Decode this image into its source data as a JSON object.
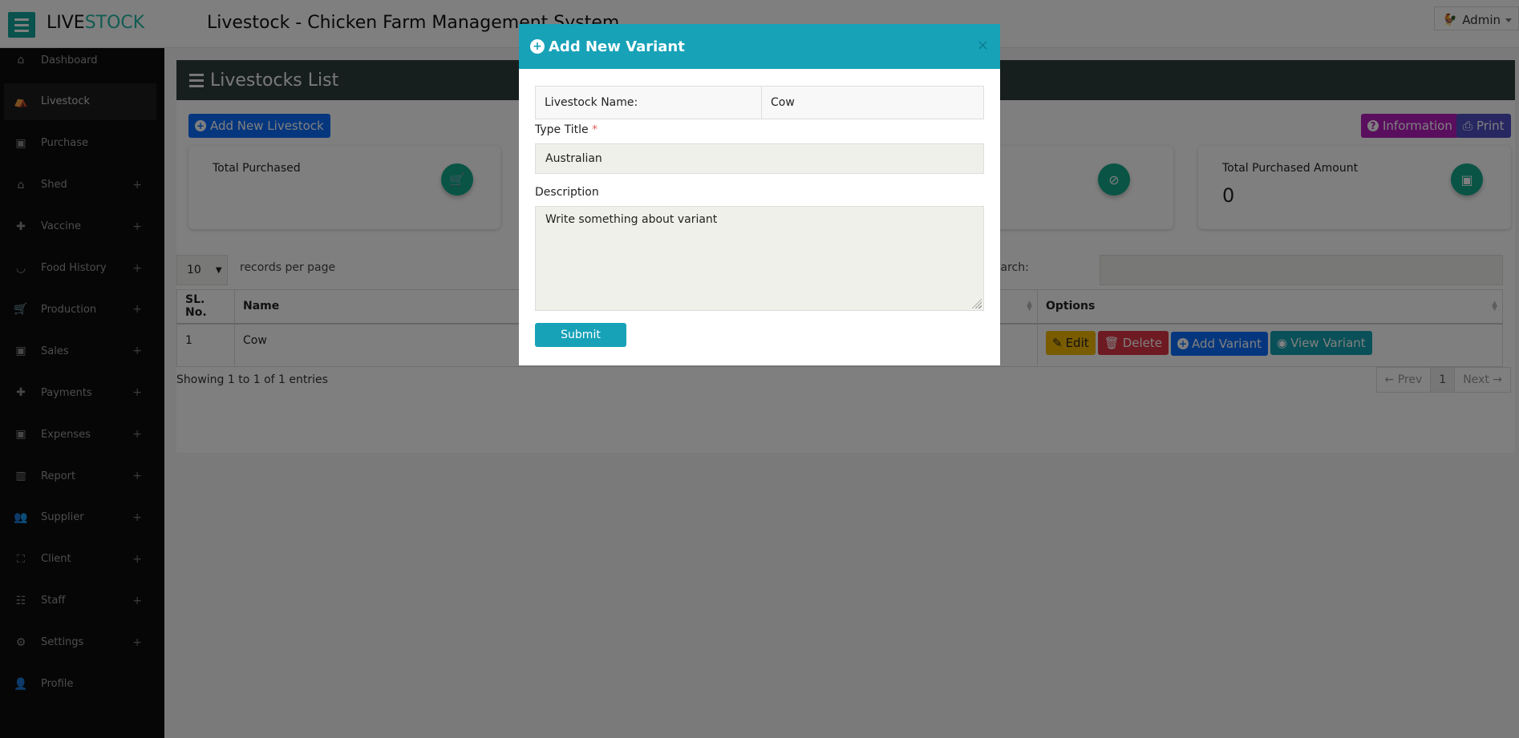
{
  "topbar": {
    "logo_part1": "LIVE",
    "logo_part2": "STOCK",
    "title": "Livestock - Chicken Farm Management System",
    "user": "Admin"
  },
  "sidebar": {
    "items": [
      {
        "label": "Dashboard",
        "icon": "home-icon",
        "expandable": false,
        "active": false
      },
      {
        "label": "Livestock",
        "icon": "livestock-icon",
        "expandable": false,
        "active": true
      },
      {
        "label": "Purchase",
        "icon": "money-icon",
        "expandable": false,
        "active": false
      },
      {
        "label": "Shed",
        "icon": "home-icon",
        "expandable": true,
        "active": false
      },
      {
        "label": "Vaccine",
        "icon": "medkit-icon",
        "expandable": true,
        "active": false
      },
      {
        "label": "Food History",
        "icon": "bowl-icon",
        "expandable": true,
        "active": false
      },
      {
        "label": "Production",
        "icon": "cart-icon",
        "expandable": true,
        "active": false
      },
      {
        "label": "Sales",
        "icon": "money-icon",
        "expandable": true,
        "active": false
      },
      {
        "label": "Payments",
        "icon": "medkit-icon",
        "expandable": true,
        "active": false
      },
      {
        "label": "Expenses",
        "icon": "money-icon",
        "expandable": true,
        "active": false
      },
      {
        "label": "Report",
        "icon": "chart-icon",
        "expandable": true,
        "active": false
      },
      {
        "label": "Supplier",
        "icon": "users-icon",
        "expandable": true,
        "active": false
      },
      {
        "label": "Client",
        "icon": "client-icon",
        "expandable": true,
        "active": false
      },
      {
        "label": "Staff",
        "icon": "staff-icon",
        "expandable": true,
        "active": false
      },
      {
        "label": "Settings",
        "icon": "gears-icon",
        "expandable": true,
        "active": false
      },
      {
        "label": "Profile",
        "icon": "user-icon",
        "expandable": false,
        "active": false
      }
    ],
    "plus_glyph": "+"
  },
  "main": {
    "panel_title": "Livestocks List",
    "add_button": "Add New Livestock",
    "information_button": "Information",
    "print_button": "Print",
    "cards": [
      {
        "title": "Total Purchased",
        "value": "",
        "icon": "cart-icon"
      },
      {
        "title": "",
        "value": "",
        "icon": "no-shop-icon"
      },
      {
        "title": "Total Purchased Amount",
        "value": "0",
        "icon": "money-icon"
      }
    ],
    "records_per_page": "10",
    "records_per_page_label": "records per page",
    "search_label": "Search:",
    "search_value": "",
    "table": {
      "headers": [
        "SL. No.",
        "Name",
        "",
        "",
        "Options"
      ],
      "rows": [
        {
          "sl": "1",
          "name": "Cow",
          "c3": "",
          "c4": ""
        }
      ],
      "actions": [
        "Edit",
        "Delete",
        "Add Variant",
        "View Variant"
      ]
    },
    "showing": "Showing 1 to 1 of 1 entries",
    "pagination": {
      "prev": "← Prev",
      "current": "1",
      "next": "Next →"
    }
  },
  "modal": {
    "title": "Add New Variant",
    "close": "×",
    "livestock_name_label": "Livestock Name:",
    "livestock_name_value": "Cow",
    "type_title_label": "Type Title",
    "required_mark": "*",
    "type_title_value": "Australian",
    "description_label": "Description",
    "description_placeholder": "Write something about variant",
    "submit": "Submit"
  },
  "colors": {
    "brand": "#13a59a",
    "modal_header": "#17a2b8",
    "primary": "#0d6efd",
    "danger": "#dc3545",
    "warning": "#f3b700"
  }
}
